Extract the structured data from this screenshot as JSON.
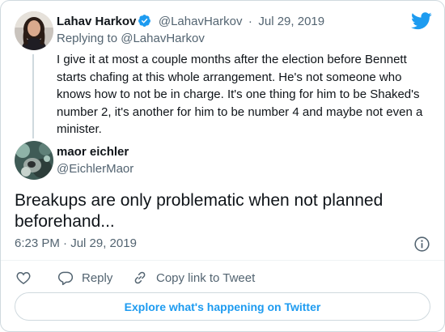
{
  "colors": {
    "twitter_blue": "#1d9bf0",
    "text_primary": "#0f1419",
    "text_muted": "#536471",
    "border": "#cfd9de"
  },
  "parent_tweet": {
    "author_name": "Lahav Harkov",
    "verified": true,
    "handle": "@LahavHarkov",
    "separator": "·",
    "date": "Jul 29, 2019",
    "replying_to_prefix": "Replying to",
    "replying_to_handle": "@LahavHarkov",
    "text": "I give it at most a couple months after the election before Bennett starts chafing at this whole arrangement. He's not someone who knows how to not be in charge. It's one thing for him to be Shaked's number 2, it's another for him to be number 4 and maybe not even a minister."
  },
  "main_tweet": {
    "author_name": "maor eichler",
    "handle": "@EichlerMaor",
    "text": "Breakups are only problematic when not planned beforehand...",
    "timestamp": "6:23 PM · Jul 29, 2019"
  },
  "actions": {
    "reply_label": "Reply",
    "copy_link_label": "Copy link to Tweet"
  },
  "footer": {
    "explore_label": "Explore what's happening on Twitter"
  },
  "icons": [
    "twitter-bird-icon",
    "verified-badge-icon",
    "info-icon",
    "heart-icon",
    "reply-icon",
    "link-icon"
  ]
}
